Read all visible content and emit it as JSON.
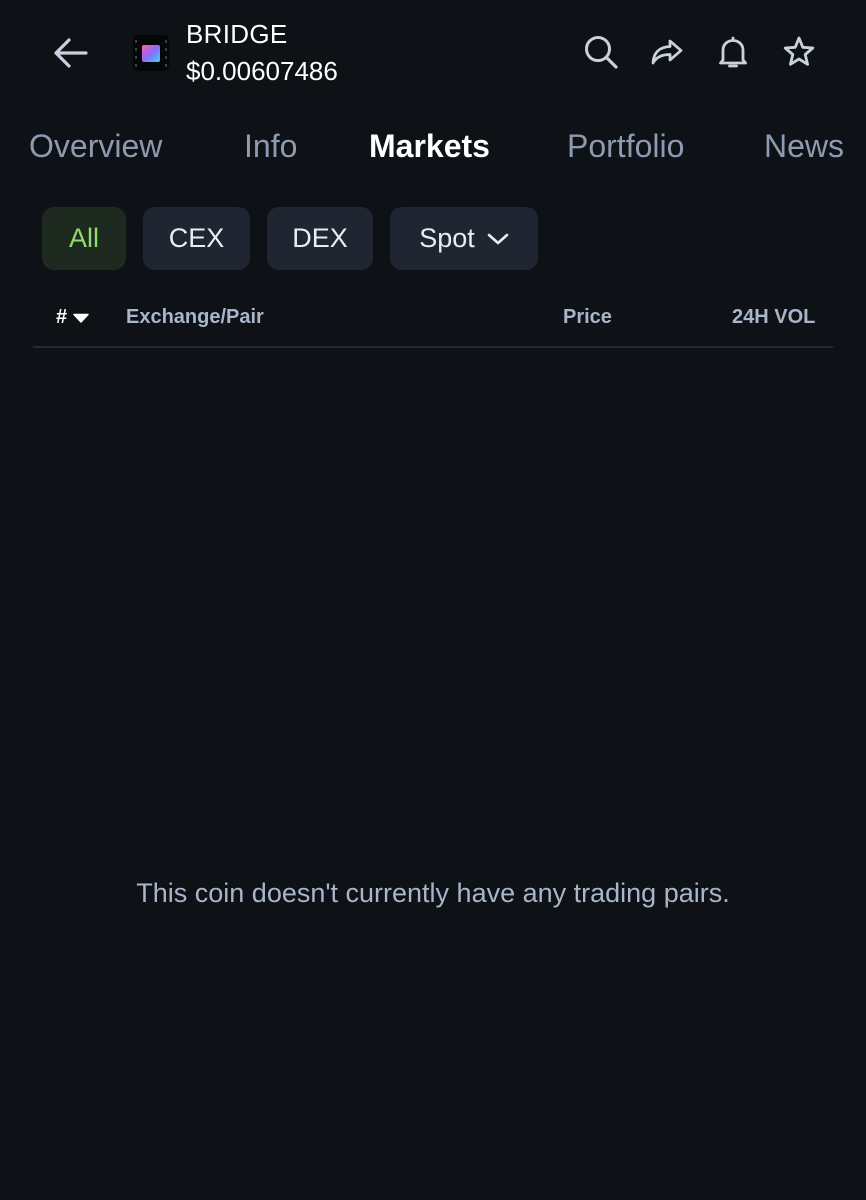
{
  "coin": {
    "name": "BRIDGE",
    "price": "$0.00607486",
    "logo_icon": "bridge-coin-logo"
  },
  "header": {
    "icons": [
      "back-arrow-icon",
      "search-icon",
      "share-icon",
      "bell-icon",
      "star-icon"
    ]
  },
  "tabs": [
    {
      "label": "Overview",
      "active": false
    },
    {
      "label": "Info",
      "active": false
    },
    {
      "label": "Markets",
      "active": true
    },
    {
      "label": "Portfolio",
      "active": false
    },
    {
      "label": "News",
      "active": false
    }
  ],
  "filters": {
    "all": "All",
    "cex": "CEX",
    "dex": "DEX",
    "type": "Spot",
    "selected": "All"
  },
  "table": {
    "columns": {
      "rank": "#",
      "pair": "Exchange/Pair",
      "price": "Price",
      "volume": "24H VOL"
    }
  },
  "empty_state": {
    "message": "This coin doesn't currently have any trading pairs."
  },
  "colors": {
    "background": "#0e1116",
    "chip_background": "#1f2632",
    "active_chip_background": "#1e2a1f",
    "active_chip_text": "#8fdc6a",
    "muted_text": "#8e9ab0"
  }
}
